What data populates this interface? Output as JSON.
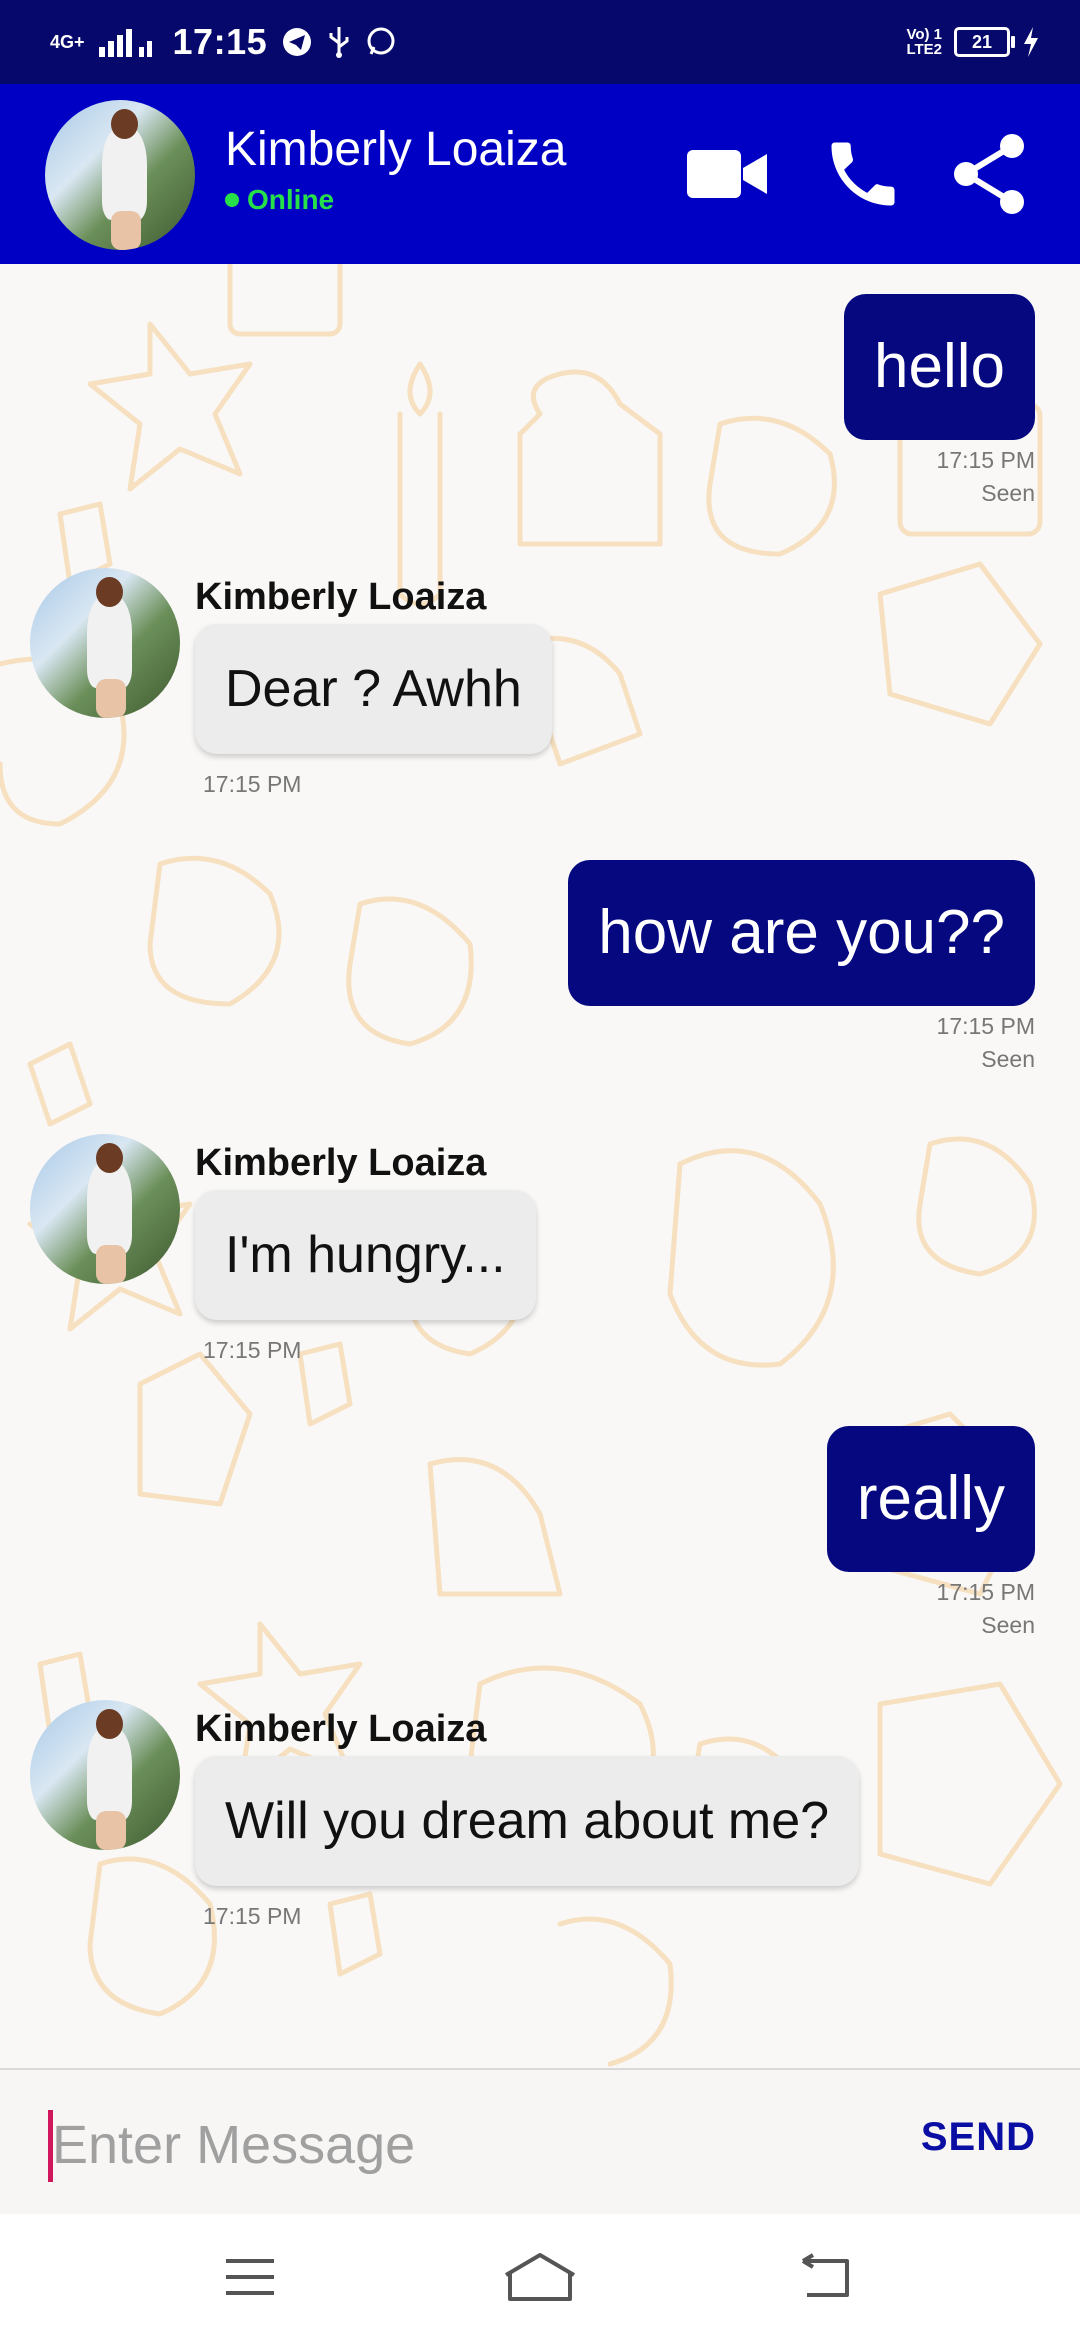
{
  "status_bar": {
    "network": "4G+",
    "time": "17:15",
    "volte": "Vo) 1",
    "lte": "LTE2",
    "battery": "21"
  },
  "header": {
    "contact_name": "Kimberly Loaiza",
    "status": "Online",
    "icons": [
      "video-call-icon",
      "phone-icon",
      "share-icon"
    ]
  },
  "messages": [
    {
      "direction": "out",
      "text": "hello",
      "time": "17:15 PM",
      "state": "Seen"
    },
    {
      "direction": "in",
      "sender": "Kimberly Loaiza",
      "text": "Dear ? Awhh",
      "time": "17:15 PM"
    },
    {
      "direction": "out",
      "text": "how are you??",
      "time": "17:15 PM",
      "state": "Seen"
    },
    {
      "direction": "in",
      "sender": "Kimberly Loaiza",
      "text": "I'm hungry...",
      "time": "17:15 PM"
    },
    {
      "direction": "out",
      "text": "really",
      "time": "17:15 PM",
      "state": "Seen"
    },
    {
      "direction": "in",
      "sender": "Kimberly Loaiza",
      "text": "Will you dream about me?",
      "time": "17:15 PM"
    }
  ],
  "composer": {
    "placeholder": "Enter Message",
    "value": "",
    "send_label": "SEND"
  },
  "nav": [
    "menu-icon",
    "home-icon",
    "back-icon"
  ],
  "colors": {
    "status_bar": "#06086b",
    "app_bar": "#0000c4",
    "outgoing_bubble": "#05087f",
    "incoming_bubble": "#ececec",
    "online": "#26e04a",
    "send": "#0b0ea3"
  }
}
